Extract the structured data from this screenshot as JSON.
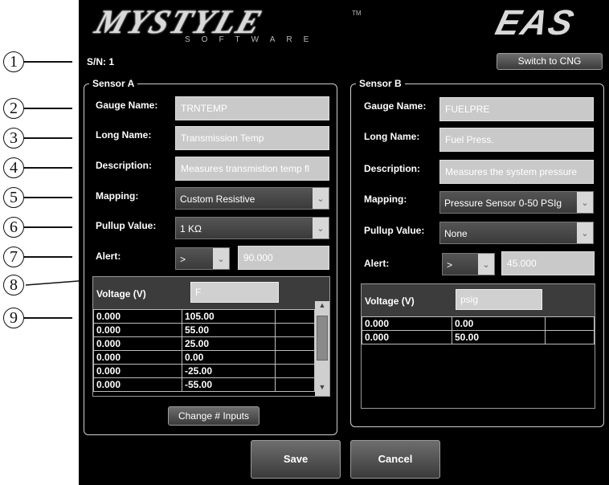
{
  "callouts": [
    "1",
    "2",
    "3",
    "4",
    "5",
    "6",
    "7",
    "8",
    "9"
  ],
  "header": {
    "logo_word": "MYSTYLE",
    "logo_sub": "SOFTWARE",
    "logo_tm": "TM",
    "eas": "EAS"
  },
  "serial": "S/N: 1",
  "switch_label": "Switch to CNG",
  "sensor_a": {
    "title": "Sensor A",
    "gauge_label": "Gauge Name:",
    "gauge_value": "TRNTEMP",
    "long_label": "Long Name:",
    "long_value": "Transmission Temp",
    "desc_label": "Description:",
    "desc_value": "Measures transmistion temp fl",
    "mapping_label": "Mapping:",
    "mapping_value": "Custom Resistive",
    "pullup_label": "Pullup Value:",
    "pullup_value": "1 KΩ",
    "alert_label": "Alert:",
    "alert_op": ">",
    "alert_value": "90.000",
    "col_voltage": "Voltage (V)",
    "col_unit": "F",
    "rows": [
      [
        "0.000",
        "105.00"
      ],
      [
        "0.000",
        "55.00"
      ],
      [
        "0.000",
        "25.00"
      ],
      [
        "0.000",
        "0.00"
      ],
      [
        "0.000",
        "-25.00"
      ],
      [
        "0.000",
        "-55.00"
      ]
    ],
    "change_inputs": "Change # Inputs"
  },
  "sensor_b": {
    "title": "Sensor B",
    "gauge_label": "Gauge Name:",
    "gauge_value": "FUELPRE",
    "long_label": "Long Name:",
    "long_value": "Fuel Press.",
    "desc_label": "Description:",
    "desc_value": "Measures the system pressure",
    "mapping_label": "Mapping:",
    "mapping_value": "Pressure Sensor 0-50 PSIg",
    "pullup_label": "Pullup Value:",
    "pullup_value": "None",
    "alert_label": "Alert:",
    "alert_op": ">",
    "alert_value": "45.000",
    "col_voltage": "Voltage (V)",
    "col_unit": "psig",
    "rows": [
      [
        "0.000",
        "0.00"
      ],
      [
        "0.000",
        "50.00"
      ]
    ]
  },
  "save_label": "Save",
  "cancel_label": "Cancel",
  "icons": {
    "dropdown": "chevron-down-icon"
  }
}
